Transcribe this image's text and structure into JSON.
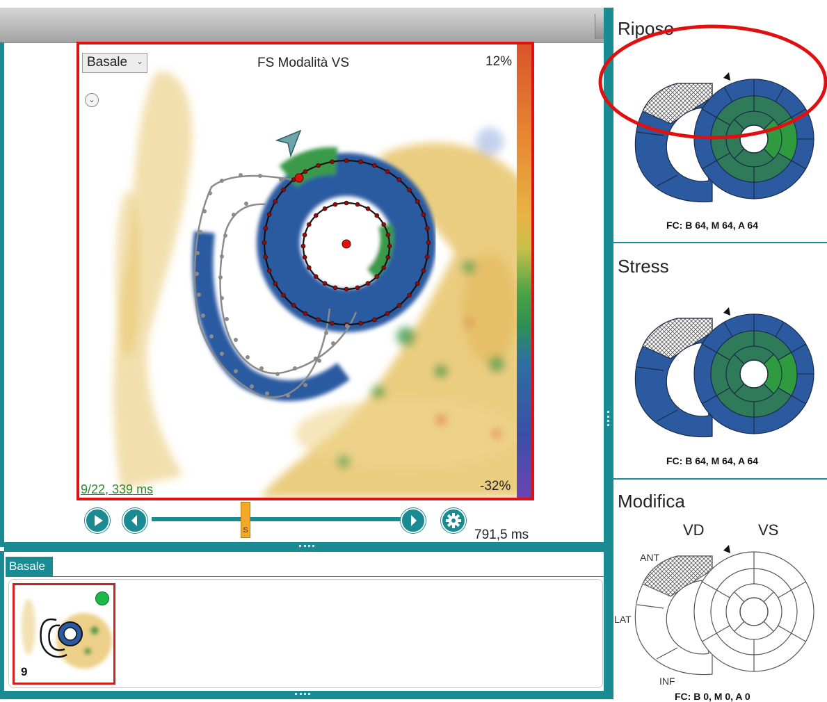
{
  "viewer": {
    "dropdown_value": "Basale",
    "title": "FS Modalità VS",
    "scale_max": "12%",
    "scale_min": "-32%",
    "frame_info": "9/22, 339 ms"
  },
  "playback": {
    "marker_label": "S",
    "time_readout": "791,5 ms"
  },
  "thumbnails": {
    "tab_label": "Basale",
    "items": [
      {
        "frame_number": "9",
        "status": "complete"
      }
    ]
  },
  "panels": {
    "riposo": {
      "title": "Riposo",
      "fc": "FC: B 64, M 64, A 64"
    },
    "stress": {
      "title": "Stress",
      "fc": "FC: B 64, M 64, A 64"
    },
    "modifica": {
      "title": "Modifica",
      "label_vd": "VD",
      "label_vs": "VS",
      "label_ant": "ANT",
      "label_lat": "LAT",
      "label_inf": "INF",
      "fc": "FC: B 0, M 0, A 0"
    }
  },
  "colors": {
    "teal": "#1a8a93",
    "segment_blue": "#2c5aa0",
    "segment_green": "#3a8f4a",
    "segment_light_green": "#2f9a40",
    "highlight_red": "#e01010"
  },
  "icons": [
    "play-icon",
    "step-back-icon",
    "step-forward-icon",
    "gear-icon",
    "chevron-down-icon"
  ]
}
